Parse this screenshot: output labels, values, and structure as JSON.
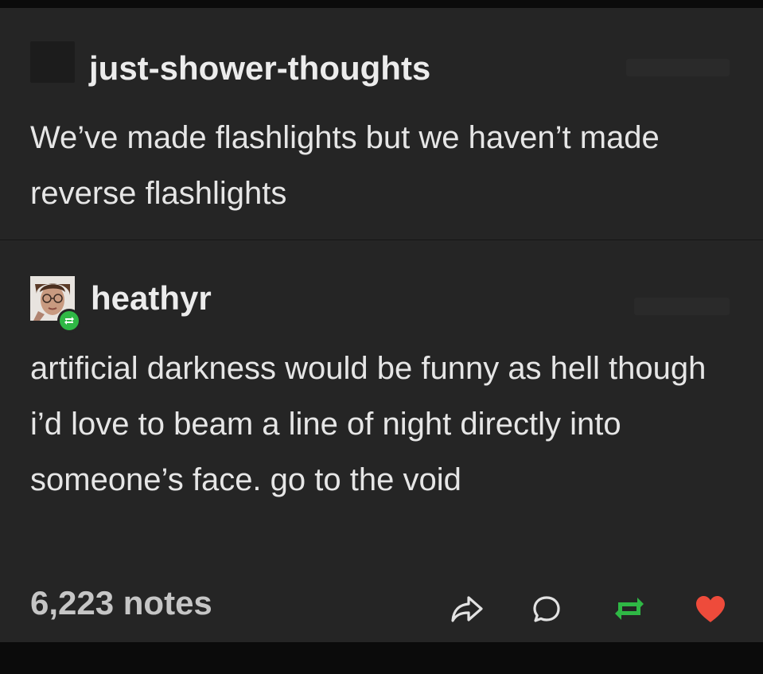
{
  "post": {
    "original": {
      "blog_name": "just-shower-thoughts",
      "text": "We’ve made flashlights but we haven’t made reverse flashlights"
    },
    "reblog": {
      "blog_name": "heathyr",
      "text": "artificial darkness would be funny as hell though i’d love to beam a line of night directly into someone’s face. go to the void"
    },
    "footer": {
      "notes": "6,223 notes",
      "actions": [
        {
          "name": "share",
          "icon": "share-arrow-icon"
        },
        {
          "name": "reply",
          "icon": "speech-bubble-icon"
        },
        {
          "name": "reblog",
          "icon": "reblog-arrows-icon"
        },
        {
          "name": "like",
          "icon": "heart-icon"
        }
      ]
    }
  },
  "colors": {
    "background": "#252525",
    "frame": "#0b0b0b",
    "text": "#e6e6e6",
    "notes_text": "#c6c6c6",
    "reblog_green": "#2fb845",
    "like_red": "#ee4b3b",
    "icon_white": "#e2e2e2"
  }
}
